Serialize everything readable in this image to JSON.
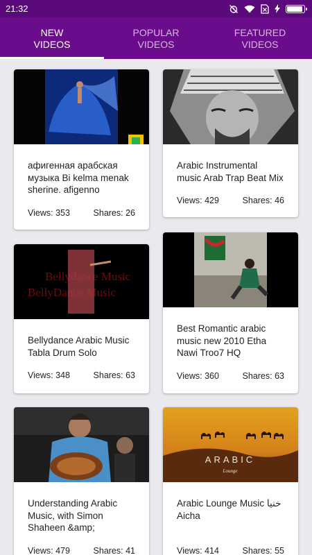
{
  "status_bar": {
    "time": "21:32",
    "icons": [
      "alarm-off-icon",
      "wifi-icon",
      "sim-x-icon",
      "charging-icon",
      "battery-icon"
    ],
    "battery_level": 0.95
  },
  "tabs": [
    {
      "label": "NEW\nVIDEOS",
      "active": true
    },
    {
      "label": "POPULAR\nVIDEOS",
      "active": false
    },
    {
      "label": "FEATURED\nVIDEOS",
      "active": false
    }
  ],
  "videos": [
    {
      "title": "афигенная арабская музыка  Bi kelma menak sherine. afigenno Arabic…",
      "views": "Views: 353",
      "shares": "Shares: 26"
    },
    {
      "title": "Arabic Instrumental music Arab Trap Beat Mix HD",
      "views": "Views: 429",
      "shares": "Shares: 46"
    },
    {
      "title": "Bellydance Arabic Music Tabla Drum Solo",
      "views": "Views: 348",
      "shares": "Shares: 63",
      "thumb_text": "Bellydance Music\nBellyDance Music"
    },
    {
      "title": "Best Romantic arabic music new 2010 Etha Nawi Troo7 HQ",
      "views": "Views: 360",
      "shares": "Shares: 63"
    },
    {
      "title": "Understanding Arabic Music, with Simon Shaheen &amp; Qantara…",
      "views": "Views: 479",
      "shares": "Shares: 41"
    },
    {
      "title": "Arabic Lounge Music خنيا Aicha",
      "views": "Views: 414",
      "shares": "Shares: 55",
      "thumb_text": "ARABIC",
      "thumb_subtext": "Lounge"
    }
  ],
  "colors": {
    "status_bar": "#5a0a7a",
    "tab_bar": "#6a0c8c",
    "background": "#e9e9ee"
  }
}
